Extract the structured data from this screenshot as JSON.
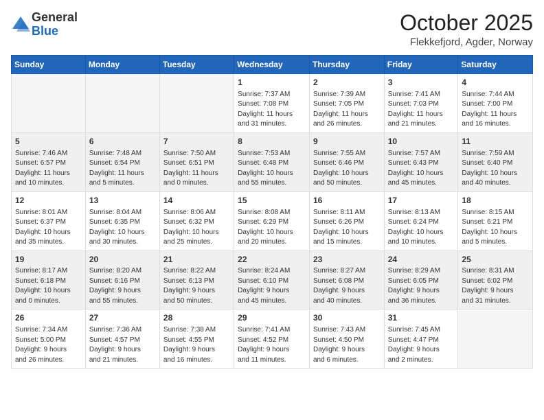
{
  "logo": {
    "general": "General",
    "blue": "Blue"
  },
  "header": {
    "month": "October 2025",
    "location": "Flekkefjord, Agder, Norway"
  },
  "weekdays": [
    "Sunday",
    "Monday",
    "Tuesday",
    "Wednesday",
    "Thursday",
    "Friday",
    "Saturday"
  ],
  "weeks": [
    [
      {
        "day": "",
        "info": ""
      },
      {
        "day": "",
        "info": ""
      },
      {
        "day": "",
        "info": ""
      },
      {
        "day": "1",
        "info": "Sunrise: 7:37 AM\nSunset: 7:08 PM\nDaylight: 11 hours\nand 31 minutes."
      },
      {
        "day": "2",
        "info": "Sunrise: 7:39 AM\nSunset: 7:05 PM\nDaylight: 11 hours\nand 26 minutes."
      },
      {
        "day": "3",
        "info": "Sunrise: 7:41 AM\nSunset: 7:03 PM\nDaylight: 11 hours\nand 21 minutes."
      },
      {
        "day": "4",
        "info": "Sunrise: 7:44 AM\nSunset: 7:00 PM\nDaylight: 11 hours\nand 16 minutes."
      }
    ],
    [
      {
        "day": "5",
        "info": "Sunrise: 7:46 AM\nSunset: 6:57 PM\nDaylight: 11 hours\nand 10 minutes."
      },
      {
        "day": "6",
        "info": "Sunrise: 7:48 AM\nSunset: 6:54 PM\nDaylight: 11 hours\nand 5 minutes."
      },
      {
        "day": "7",
        "info": "Sunrise: 7:50 AM\nSunset: 6:51 PM\nDaylight: 11 hours\nand 0 minutes."
      },
      {
        "day": "8",
        "info": "Sunrise: 7:53 AM\nSunset: 6:48 PM\nDaylight: 10 hours\nand 55 minutes."
      },
      {
        "day": "9",
        "info": "Sunrise: 7:55 AM\nSunset: 6:46 PM\nDaylight: 10 hours\nand 50 minutes."
      },
      {
        "day": "10",
        "info": "Sunrise: 7:57 AM\nSunset: 6:43 PM\nDaylight: 10 hours\nand 45 minutes."
      },
      {
        "day": "11",
        "info": "Sunrise: 7:59 AM\nSunset: 6:40 PM\nDaylight: 10 hours\nand 40 minutes."
      }
    ],
    [
      {
        "day": "12",
        "info": "Sunrise: 8:01 AM\nSunset: 6:37 PM\nDaylight: 10 hours\nand 35 minutes."
      },
      {
        "day": "13",
        "info": "Sunrise: 8:04 AM\nSunset: 6:35 PM\nDaylight: 10 hours\nand 30 minutes."
      },
      {
        "day": "14",
        "info": "Sunrise: 8:06 AM\nSunset: 6:32 PM\nDaylight: 10 hours\nand 25 minutes."
      },
      {
        "day": "15",
        "info": "Sunrise: 8:08 AM\nSunset: 6:29 PM\nDaylight: 10 hours\nand 20 minutes."
      },
      {
        "day": "16",
        "info": "Sunrise: 8:11 AM\nSunset: 6:26 PM\nDaylight: 10 hours\nand 15 minutes."
      },
      {
        "day": "17",
        "info": "Sunrise: 8:13 AM\nSunset: 6:24 PM\nDaylight: 10 hours\nand 10 minutes."
      },
      {
        "day": "18",
        "info": "Sunrise: 8:15 AM\nSunset: 6:21 PM\nDaylight: 10 hours\nand 5 minutes."
      }
    ],
    [
      {
        "day": "19",
        "info": "Sunrise: 8:17 AM\nSunset: 6:18 PM\nDaylight: 10 hours\nand 0 minutes."
      },
      {
        "day": "20",
        "info": "Sunrise: 8:20 AM\nSunset: 6:16 PM\nDaylight: 9 hours\nand 55 minutes."
      },
      {
        "day": "21",
        "info": "Sunrise: 8:22 AM\nSunset: 6:13 PM\nDaylight: 9 hours\nand 50 minutes."
      },
      {
        "day": "22",
        "info": "Sunrise: 8:24 AM\nSunset: 6:10 PM\nDaylight: 9 hours\nand 45 minutes."
      },
      {
        "day": "23",
        "info": "Sunrise: 8:27 AM\nSunset: 6:08 PM\nDaylight: 9 hours\nand 40 minutes."
      },
      {
        "day": "24",
        "info": "Sunrise: 8:29 AM\nSunset: 6:05 PM\nDaylight: 9 hours\nand 36 minutes."
      },
      {
        "day": "25",
        "info": "Sunrise: 8:31 AM\nSunset: 6:02 PM\nDaylight: 9 hours\nand 31 minutes."
      }
    ],
    [
      {
        "day": "26",
        "info": "Sunrise: 7:34 AM\nSunset: 5:00 PM\nDaylight: 9 hours\nand 26 minutes."
      },
      {
        "day": "27",
        "info": "Sunrise: 7:36 AM\nSunset: 4:57 PM\nDaylight: 9 hours\nand 21 minutes."
      },
      {
        "day": "28",
        "info": "Sunrise: 7:38 AM\nSunset: 4:55 PM\nDaylight: 9 hours\nand 16 minutes."
      },
      {
        "day": "29",
        "info": "Sunrise: 7:41 AM\nSunset: 4:52 PM\nDaylight: 9 hours\nand 11 minutes."
      },
      {
        "day": "30",
        "info": "Sunrise: 7:43 AM\nSunset: 4:50 PM\nDaylight: 9 hours\nand 6 minutes."
      },
      {
        "day": "31",
        "info": "Sunrise: 7:45 AM\nSunset: 4:47 PM\nDaylight: 9 hours\nand 2 minutes."
      },
      {
        "day": "",
        "info": ""
      }
    ]
  ]
}
